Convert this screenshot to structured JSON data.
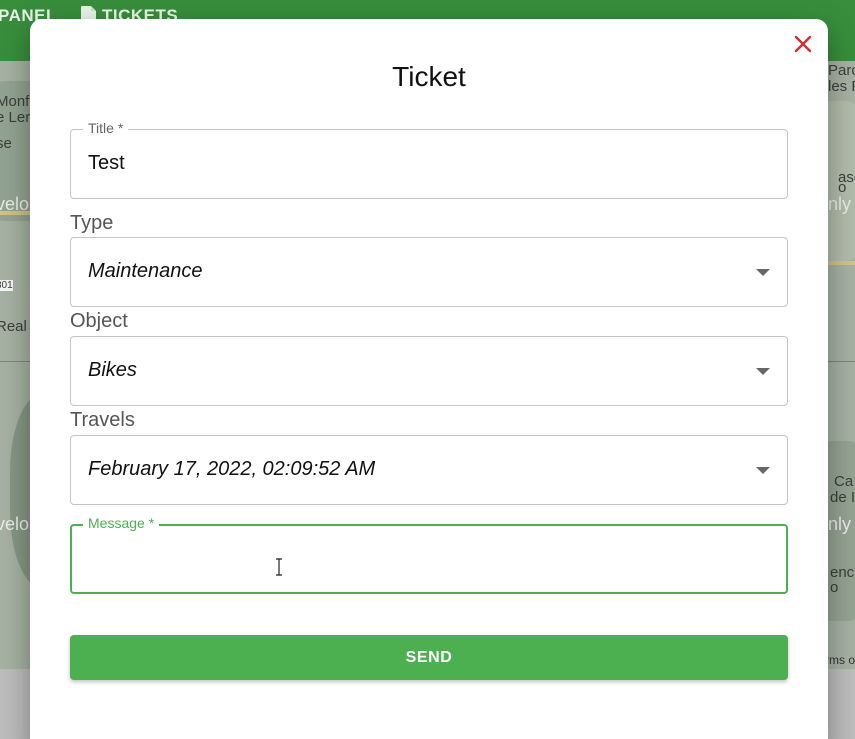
{
  "appbar": {
    "nav_panel": "PANEL",
    "nav_tickets": "TICKETS"
  },
  "map": {
    "labels": [
      "Monfo",
      "e Ler",
      "se",
      "velo",
      "301",
      "Real",
      "velo",
      "Parc",
      "les P",
      "nly",
      "asca",
      "o",
      "Ca",
      "de I",
      "nly",
      "enc",
      "o"
    ],
    "terms": "rms o"
  },
  "modal": {
    "title": "Ticket",
    "close_icon": "close-icon",
    "title_field": {
      "label": "Title *",
      "value": "Test"
    },
    "type_field": {
      "label": "Type",
      "value": "Maintenance"
    },
    "object_field": {
      "label": "Object",
      "value": "Bikes"
    },
    "travels_field": {
      "label": "Travels",
      "value": "February 17, 2022, 02:09:52 AM"
    },
    "message_field": {
      "label": "Message *",
      "value": ""
    },
    "send_label": "SEND"
  },
  "colors": {
    "accent_green": "#4caf50",
    "appbar_green": "#388e3c",
    "close_red": "#d32f2f"
  }
}
